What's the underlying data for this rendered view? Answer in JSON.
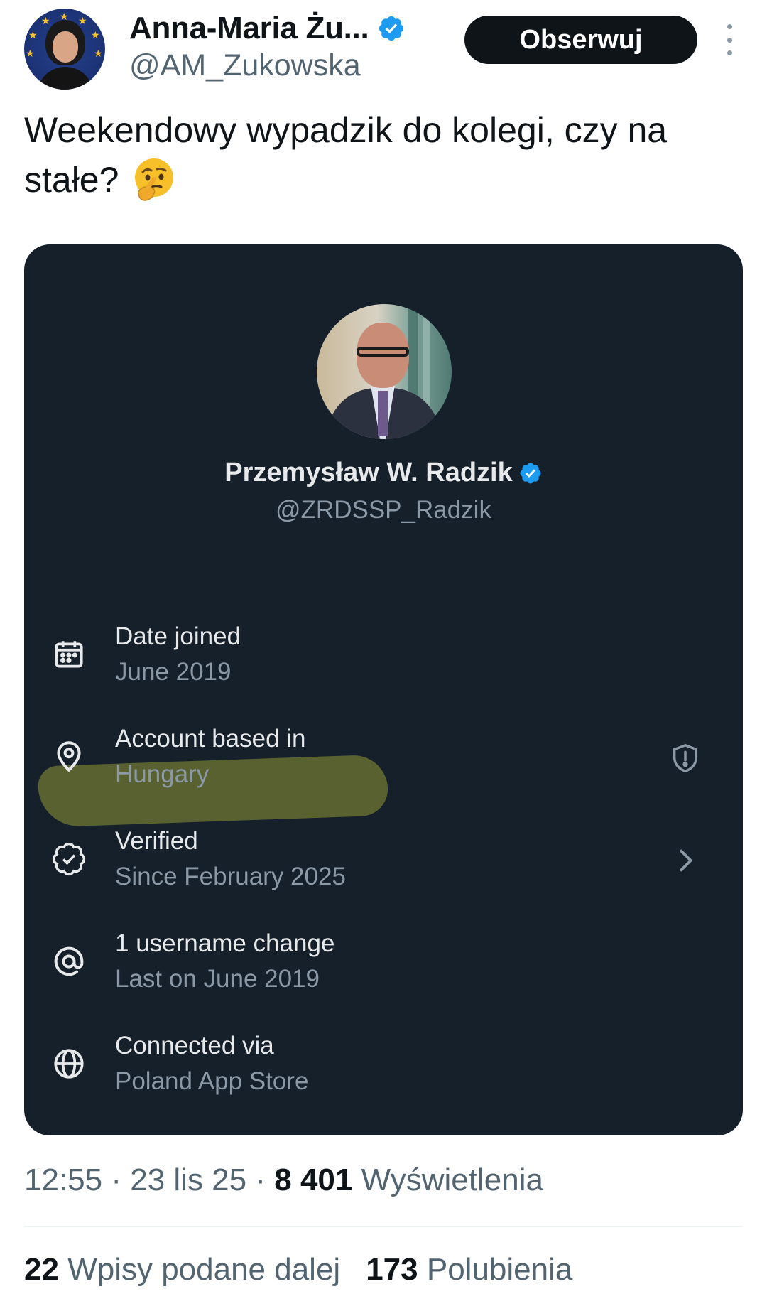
{
  "author": {
    "name": "Anna-Maria Żu...",
    "handle": "@AM_Zukowska",
    "verified": true
  },
  "actions": {
    "follow_label": "Obserwuj",
    "more_icon": "more-vertical-icon"
  },
  "tweet": {
    "text": "Weekendowy wypadzik do kolegi, czy na stałe?",
    "emoji": "thinking-face"
  },
  "card": {
    "name": "Przemysław W. Radzik",
    "handle": "@ZRDSSP_Radzik",
    "verified": true,
    "rows": [
      {
        "icon": "calendar-icon",
        "label": "Date joined",
        "value": "June 2019"
      },
      {
        "icon": "location-pin-icon",
        "label": "Account based in",
        "value": "Hungary",
        "right_icon": "shield-icon"
      },
      {
        "icon": "verified-badge-outline-icon",
        "label": "Verified",
        "value": "Since February 2025",
        "right_icon": "chevron-right-icon"
      },
      {
        "icon": "at-sign-icon",
        "label": "1 username change",
        "value": "Last on June 2019"
      },
      {
        "icon": "globe-icon",
        "label": "Connected via",
        "value": "Poland App Store"
      }
    ]
  },
  "meta": {
    "time": "12:55",
    "date": "23 lis 25",
    "views_count": "8 401",
    "views_label": "Wyświetlenia",
    "separator": "·"
  },
  "stats": {
    "reposts_count": "22",
    "reposts_label": "Wpisy podane dalej",
    "likes_count": "173",
    "likes_label": "Polubienia"
  },
  "colors": {
    "verified_blue": "#1d9bf0",
    "card_bg": "#15202b",
    "highlight": "#c7cc3a"
  }
}
